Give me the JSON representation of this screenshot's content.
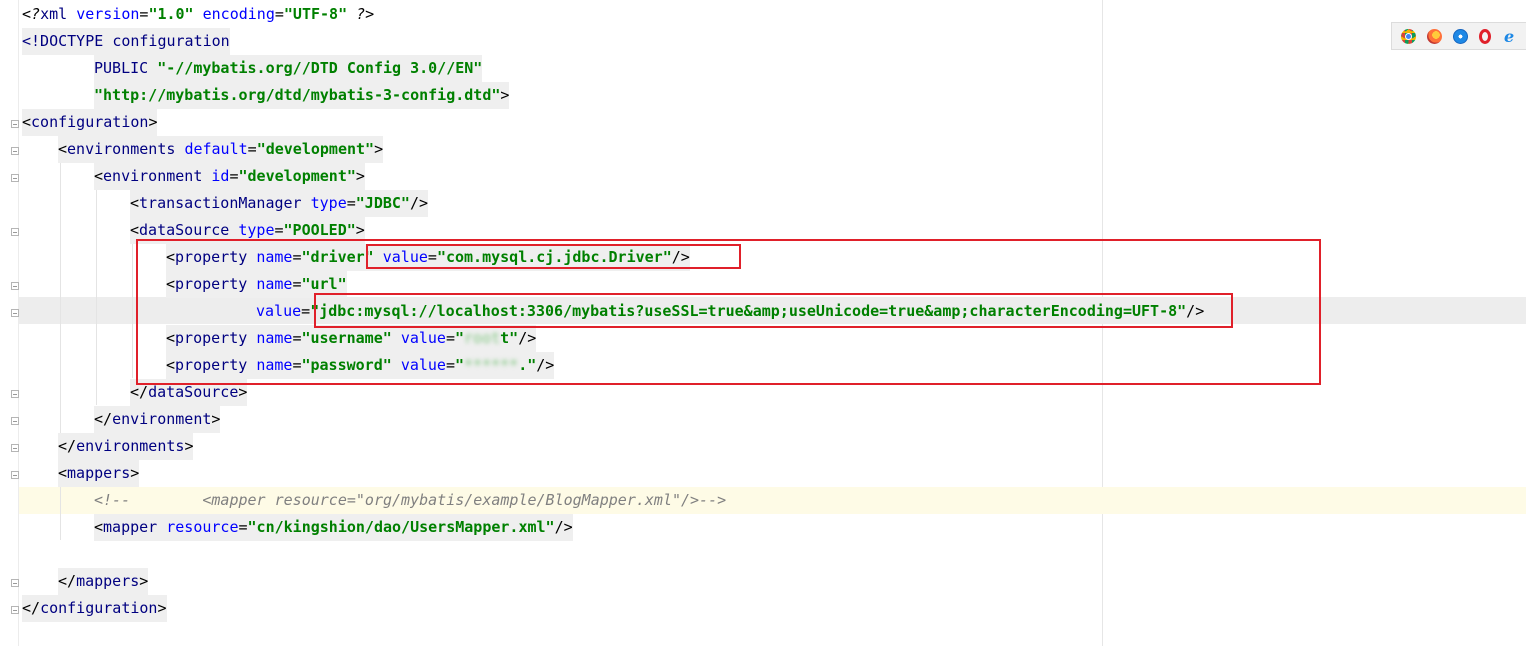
{
  "editor": {
    "lines": {
      "l1": {
        "pi_open": "<?",
        "xml": "xml",
        "version_attr": "version",
        "version_val": "\"1.0\"",
        "encoding_attr": "encoding",
        "encoding_val": "\"UTF-8\"",
        "pi_close": "?>"
      },
      "l2": {
        "doctype": "<!DOCTYPE",
        "name": "configuration"
      },
      "l3": {
        "public": "PUBLIC",
        "value": "\"-//mybatis.org//DTD Config 3.0//EN\""
      },
      "l4": {
        "value": "\"http://mybatis.org/dtd/mybatis-3-config.dtd\"",
        "close": ">"
      },
      "l5": {
        "tag": "configuration"
      },
      "l6": {
        "tag": "environments",
        "attr": "default",
        "val": "\"development\""
      },
      "l7": {
        "tag": "environment",
        "attr": "id",
        "val": "\"development\""
      },
      "l8": {
        "tag": "transactionManager",
        "attr": "type",
        "val": "\"JDBC\""
      },
      "l9": {
        "tag": "dataSource",
        "attr": "type",
        "val": "\"POOLED\""
      },
      "l10": {
        "tag": "property",
        "attr1": "name",
        "val1": "\"driver\"",
        "attr2": "value",
        "val2": "\"com.mysql.cj.jdbc.Driver\""
      },
      "l11": {
        "tag": "property",
        "attr1": "name",
        "val1": "\"url\""
      },
      "l12": {
        "attr": "value",
        "val": "\"jdbc:mysql://localhost:3306/mybatis?useSSL=true&amp;useUnicode=true&amp;characterEncoding=UFT-8\""
      },
      "l13": {
        "tag": "property",
        "attr1": "name",
        "val1": "\"username\"",
        "attr2": "value",
        "val2_open": "\"",
        "val2_blur": "root",
        "val2_tail": "t\""
      },
      "l14": {
        "tag": "property",
        "attr1": "name",
        "val1": "\"password\"",
        "attr2": "value",
        "val2_open": "\"",
        "val2_blur": "******",
        "val2_tail": ".\""
      },
      "l15": {
        "tag": "dataSource"
      },
      "l16": {
        "tag": "environment"
      },
      "l17": {
        "tag": "environments"
      },
      "l18": {
        "tag": "mappers"
      },
      "l19": {
        "comment": "<!--        <mapper resource=\"org/mybatis/example/BlogMapper.xml\"/>-->"
      },
      "l20": {
        "tag": "mapper",
        "attr": "resource",
        "val": "\"cn/kingshion/dao/UsersMapper.xml\""
      },
      "l22": {
        "tag": "mappers"
      },
      "l23": {
        "tag": "configuration"
      }
    }
  },
  "browsers": [
    "chrome-icon",
    "firefox-icon",
    "safari-icon",
    "opera-icon",
    "ie-icon"
  ],
  "ie_glyph": "e"
}
